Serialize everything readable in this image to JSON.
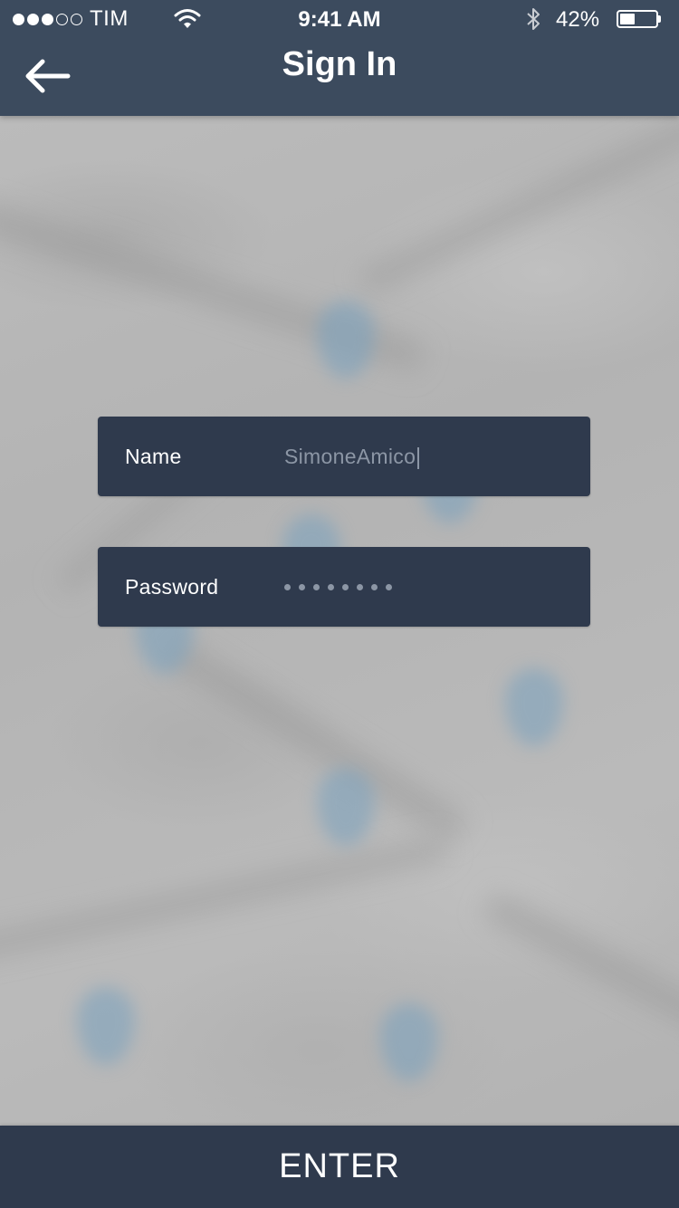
{
  "status_bar": {
    "carrier": "TIM",
    "signal_strength": 3,
    "signal_max": 5,
    "time": "9:41 AM",
    "battery_text": "42%",
    "battery_level": 0.42,
    "icons": [
      "signal-dots",
      "wifi-icon",
      "bluetooth-icon",
      "battery-icon"
    ]
  },
  "nav": {
    "title": "Sign In",
    "back_icon": "arrow-left-icon"
  },
  "form": {
    "name_label": "Name",
    "name_value": "SimoneAmico",
    "password_label": "Password",
    "password_length": 8
  },
  "enter_label": "ENTER",
  "colors": {
    "nav_background": "#3c4b5e",
    "field_background": "#2f3a4d",
    "button_background": "#2f3a4d",
    "text_primary": "#ffffff",
    "text_muted": "#8c96a5",
    "map_pin": "#78a0be"
  }
}
